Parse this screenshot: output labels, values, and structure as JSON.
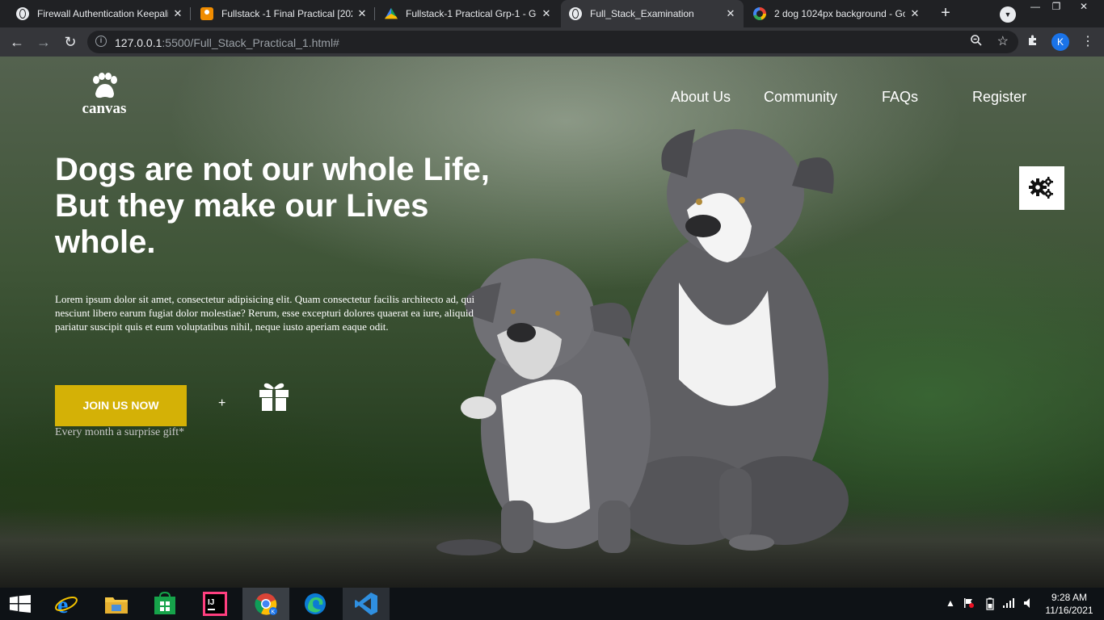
{
  "browser": {
    "tabs": [
      {
        "title": "Firewall Authentication Keepali",
        "favicon": "globe-icon",
        "active": false
      },
      {
        "title": "Fullstack -1 Final Practical [202",
        "favicon": "classroom-icon",
        "active": false
      },
      {
        "title": "Fullstack-1 Practical Grp-1 - Go",
        "favicon": "drive-icon",
        "active": false
      },
      {
        "title": "Full_Stack_Examination",
        "favicon": "globe-icon",
        "active": true
      },
      {
        "title": "2 dog 1024px background - Go",
        "favicon": "google-icon",
        "active": false
      }
    ],
    "close_glyph": "✕",
    "new_tab_glyph": "+",
    "url_host": "127.0.0.1",
    "url_rest": ":5500/Full_Stack_Practical_1.html#",
    "profile_initial": "K"
  },
  "page": {
    "logo_text": "canvas",
    "nav": [
      "About Us",
      "Community",
      "FAQs",
      "Register"
    ],
    "headline_lines": [
      "Dogs are not our whole Life,",
      "But they make our Lives",
      "whole."
    ],
    "lorem": "Lorem ipsum dolor sit amet, consectetur adipisicing elit. Quam consectetur facilis architecto ad, qui nesciunt libero earum fugiat dolor molestiae? Rerum, esse excepturi dolores quaerat ea iure, aliquid pariatur suscipit quis et eum voluptatibus nihil, neque iusto aperiam eaque odit.",
    "join_button": "JOIN US NOW",
    "plus": "+",
    "surprise": "Every month a surprise gift*",
    "accent_color": "#d4b106"
  },
  "taskbar": {
    "apps": [
      "windows-start-icon",
      "internet-explorer-icon",
      "file-explorer-icon",
      "store-icon",
      "intellij-icon",
      "chrome-icon",
      "edge-icon",
      "vscode-icon"
    ],
    "time": "9:28 AM",
    "date": "11/16/2021"
  }
}
